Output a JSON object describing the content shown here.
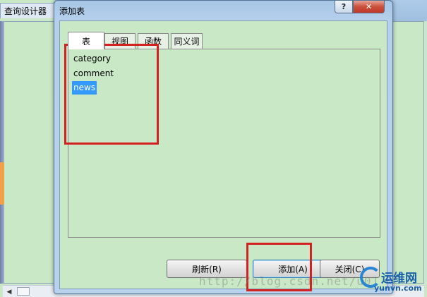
{
  "background_window": {
    "title": "查询设计器"
  },
  "dialog": {
    "title": "添加表",
    "help_label": "?",
    "close_label": "✕",
    "tabs": [
      {
        "label": "表",
        "active": true
      },
      {
        "label": "视图",
        "active": false
      },
      {
        "label": "函数",
        "active": false
      },
      {
        "label": "同义词",
        "active": false
      }
    ],
    "tables": [
      {
        "name": "category",
        "selected": false
      },
      {
        "name": "comment",
        "selected": false
      },
      {
        "name": "news",
        "selected": true
      }
    ],
    "buttons": {
      "refresh": "刷新(R)",
      "add": "添加(A)",
      "close": "关闭(C)"
    }
  },
  "watermark": {
    "url_text": "http://blog.csdn.net/u01",
    "logo_cn": "运维网",
    "logo_en": "yunvn.com"
  },
  "colors": {
    "content_bg": "#c9e9c6",
    "selection": "#3399ff",
    "annotation": "#d42020",
    "title_bar": "#b6d0ec"
  },
  "icons": {
    "help": "question-mark-icon",
    "close": "close-x-icon",
    "scroll_left": "arrow-left-icon"
  }
}
